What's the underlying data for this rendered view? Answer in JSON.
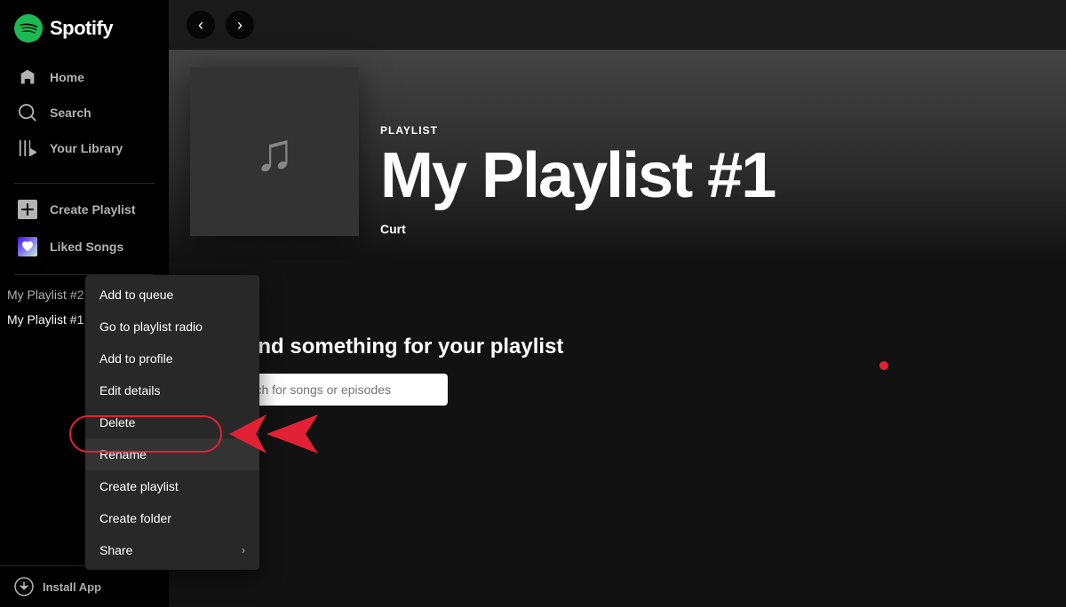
{
  "app": {
    "name": "Spotify"
  },
  "sidebar": {
    "nav": [
      {
        "id": "home",
        "label": "Home"
      },
      {
        "id": "search",
        "label": "Search"
      },
      {
        "id": "library",
        "label": "Your Library"
      }
    ],
    "actions": [
      {
        "id": "create-playlist",
        "label": "Create Playlist"
      },
      {
        "id": "liked-songs",
        "label": "Liked Songs"
      }
    ],
    "playlists": [
      {
        "id": "playlist-2",
        "label": "My Playlist #2",
        "active": false
      },
      {
        "id": "playlist-1",
        "label": "My Playlist #1",
        "active": true
      }
    ],
    "install": "Install App"
  },
  "main": {
    "playlist": {
      "type_label": "PLAYLIST",
      "title": "My Playlist #1",
      "owner": "Curt"
    },
    "controls": {
      "dots": "..."
    },
    "find": {
      "title": "Let's find something for your playlist",
      "search_placeholder": "Search for songs or episodes"
    }
  },
  "context_menu": {
    "items": [
      {
        "id": "add-to-queue",
        "label": "Add to queue",
        "has_submenu": false
      },
      {
        "id": "go-to-playlist-radio",
        "label": "Go to playlist radio",
        "has_submenu": false
      },
      {
        "id": "add-to-profile",
        "label": "Add to profile",
        "has_submenu": false
      },
      {
        "id": "edit-details",
        "label": "Edit details",
        "has_submenu": false
      },
      {
        "id": "delete",
        "label": "Delete",
        "has_submenu": false
      },
      {
        "id": "rename",
        "label": "Rename",
        "has_submenu": false,
        "highlighted": true
      },
      {
        "id": "create-playlist",
        "label": "Create playlist",
        "has_submenu": false
      },
      {
        "id": "create-folder",
        "label": "Create folder",
        "has_submenu": false
      },
      {
        "id": "share",
        "label": "Share",
        "has_submenu": true
      }
    ]
  }
}
